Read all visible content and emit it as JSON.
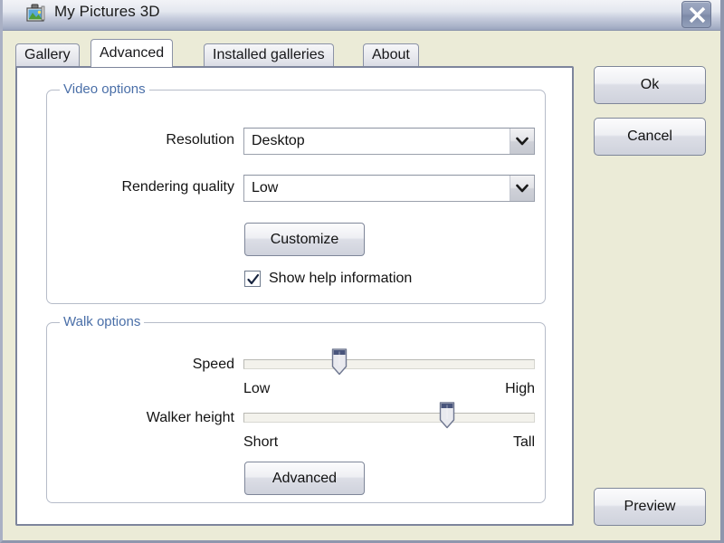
{
  "window": {
    "title": "My Pictures 3D",
    "app_icon": "picture-icon",
    "close_label": "Close",
    "close_icon": "close-icon",
    "bg_color": "#ebebd7",
    "titlebar_color": "#aab3c9"
  },
  "tabs": [
    {
      "label": "Gallery",
      "active": false
    },
    {
      "label": "Advanced",
      "active": true
    },
    {
      "label": "Installed galleries",
      "active": false
    },
    {
      "label": "About",
      "active": false
    }
  ],
  "video_options": {
    "legend": "Video options",
    "legend_color": "#4a6fa8",
    "resolution": {
      "label": "Resolution",
      "value": "Desktop",
      "arrow_icon": "chevron-down-icon"
    },
    "rendering_quality": {
      "label": "Rendering quality",
      "value": "Low",
      "arrow_icon": "chevron-down-icon"
    },
    "customize_button": "Customize",
    "show_help": {
      "label": "Show help information",
      "checked": true,
      "check_icon": "checkmark-icon"
    }
  },
  "walk_options": {
    "legend": "Walk options",
    "legend_color": "#4a6fa8",
    "speed": {
      "label": "Speed",
      "min_label": "Low",
      "max_label": "High",
      "value_percent": 33
    },
    "walker_height": {
      "label": "Walker height",
      "min_label": "Short",
      "max_label": "Tall",
      "value_percent": 70
    },
    "advanced_button": "Advanced"
  },
  "side_buttons": {
    "ok": "Ok",
    "cancel": "Cancel",
    "preview": "Preview"
  }
}
